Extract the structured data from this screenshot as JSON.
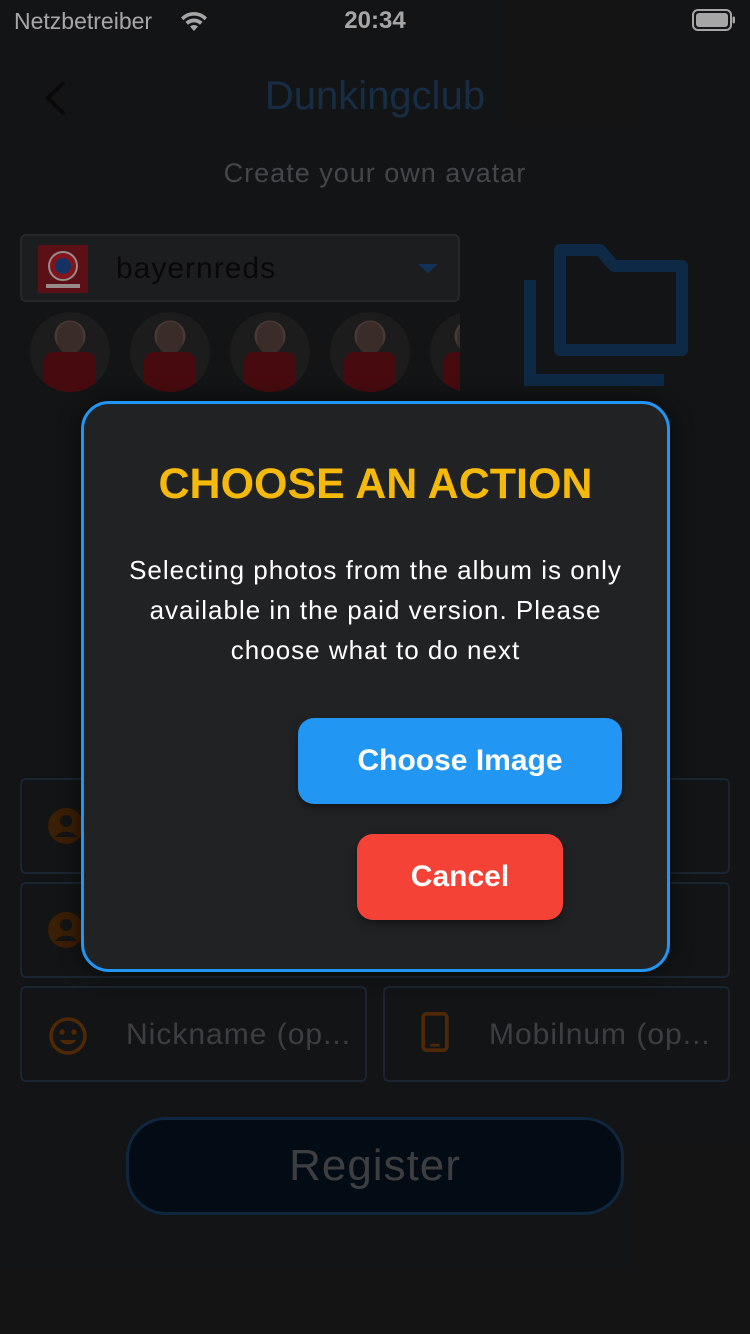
{
  "status_bar": {
    "carrier": "Netzbetreiber",
    "time": "20:34",
    "wifi_icon": "wifi-icon",
    "battery_icon": "battery-full-icon"
  },
  "header": {
    "back_icon": "chevron-left-icon",
    "title": "Dunkingclub",
    "subtitle": "Create your own avatar"
  },
  "team_select": {
    "selected": "bayernreds",
    "logo_icon": "team-logo"
  },
  "avatars": {
    "count_visible": 5
  },
  "folder_icon": "folder-icon",
  "form": {
    "field1_icon": "person-icon",
    "field2_icon": "person-icon",
    "nickname_placeholder": "Nickname (op...",
    "nickname_icon": "smiley-icon",
    "mobile_placeholder": "Mobilnum (op...",
    "mobile_icon": "phone-icon",
    "register_label": "Register"
  },
  "dialog": {
    "title": "CHOOSE AN ACTION",
    "message": "Selecting photos from the album is only available in the paid version. Please choose what to do next",
    "choose_image_label": "Choose Image",
    "cancel_label": "Cancel"
  },
  "colors": {
    "background": "#1e1f21",
    "accent_blue": "#2196f3",
    "title_yellow": "#f5b90a",
    "cancel_red": "#f44336",
    "icon_orange": "#7a3f0a"
  }
}
